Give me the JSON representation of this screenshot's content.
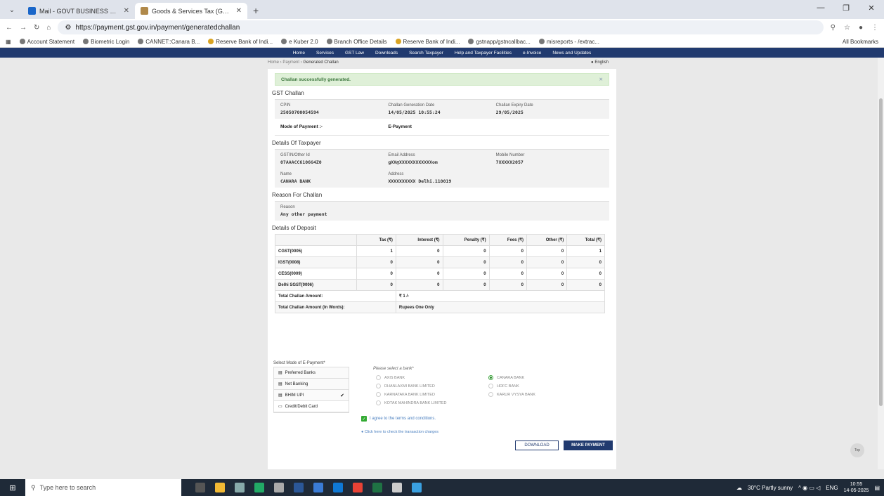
{
  "browser": {
    "tabs": [
      {
        "label": "Mail - GOVT BUSINESS SECTIO"
      },
      {
        "label": "Goods & Services Tax (GST) | P"
      }
    ],
    "url": "https://payment.gst.gov.in/payment/generatedchallan",
    "bookmarks": [
      "Account Statement",
      "Biometric Login",
      "CANNET::Canara B...",
      "Reserve Bank of Indi...",
      "e Kuber 2.0",
      "Branch Office Details",
      "Reserve Bank of Indi...",
      "gstnapp/gstncallbac...",
      "misreports - /extrac..."
    ],
    "all_bookmarks": "All Bookmarks"
  },
  "nav": [
    "Home",
    "Services",
    "GST Law",
    "Downloads",
    "Search Taxpayer",
    "Help and Taxpayer Facilities",
    "e-Invoice",
    "News and Updates"
  ],
  "breadcrumb": {
    "home": "Home",
    "payment": "Payment",
    "current": "Generated Challan",
    "lang": "English"
  },
  "alert": "Challan successfully generated.",
  "challan": {
    "heading": "GST Challan",
    "cpin_label": "CPIN",
    "cpin": "25050700054594",
    "gen_label": "Challan Generation Date",
    "gen": "14/05/2025 10:55:24",
    "exp_label": "Challan Expiry Date",
    "exp": "29/05/2025",
    "mode_label": "Mode of Payment :-",
    "mode": "E-Payment"
  },
  "taxpayer": {
    "heading": "Details Of Taxpayer",
    "gstin_label": "GSTIN/Other Id",
    "gstin": "07AAACC6106G4Z0",
    "email_label": "Email Address",
    "email": "gXX@XXXXXXXXXXXXom",
    "mobile_label": "Mobile Number",
    "mobile": "7XXXXX2057",
    "name_label": "Name",
    "name": "CANARA BANK",
    "addr_label": "Address",
    "addr": "XXXXXXXXXX Delhi.110019"
  },
  "reason": {
    "heading": "Reason For Challan",
    "label": "Reason",
    "value": "Any other payment"
  },
  "deposit": {
    "heading": "Details of Deposit",
    "cols": [
      "Tax (₹)",
      "Interest (₹)",
      "Penalty (₹)",
      "Fees (₹)",
      "Other (₹)",
      "Total (₹)"
    ],
    "rows": [
      {
        "name": "CGST(0005)",
        "v": [
          "1",
          "0",
          "0",
          "0",
          "0",
          "1"
        ]
      },
      {
        "name": "IGST(0008)",
        "v": [
          "0",
          "0",
          "0",
          "0",
          "0",
          "0"
        ]
      },
      {
        "name": "CESS(0009)",
        "v": [
          "0",
          "0",
          "0",
          "0",
          "0",
          "0"
        ]
      },
      {
        "name": "Delhi SGST(0006)",
        "v": [
          "0",
          "0",
          "0",
          "0",
          "0",
          "0"
        ]
      }
    ],
    "total_label": "Total Challan Amount:",
    "total": "₹ 1 /-",
    "words_label": "Total Challan Amount (In Words):",
    "words": "Rupees One Only"
  },
  "payment": {
    "select_label": "Select Mode of E-Payment*",
    "modes": [
      "Preferred Banks",
      "Net Banking",
      "BHIM UPI",
      "Credit/Debit Card"
    ],
    "bank_title": "Please select a bank*",
    "banks": [
      "AXIS BANK",
      "CANARA BANK",
      "DHANLAXMI BANK LIMITED",
      "HDFC BANK",
      "KARNATAKA BANK LIMITED",
      "KARUR VYSYA BANK",
      "KOTAK MAHINDRA BANK LIMITED"
    ],
    "agree": "I agree to the terms and conditions.",
    "charges": "Click here to check the transaction charges",
    "download": "DOWNLOAD",
    "make": "MAKE PAYMENT"
  },
  "totop": "Top",
  "taskbar": {
    "search": "Type here to search",
    "weather": "30°C Partly sunny",
    "lang": "ENG",
    "time": "10:55",
    "date": "14-05-2025"
  }
}
